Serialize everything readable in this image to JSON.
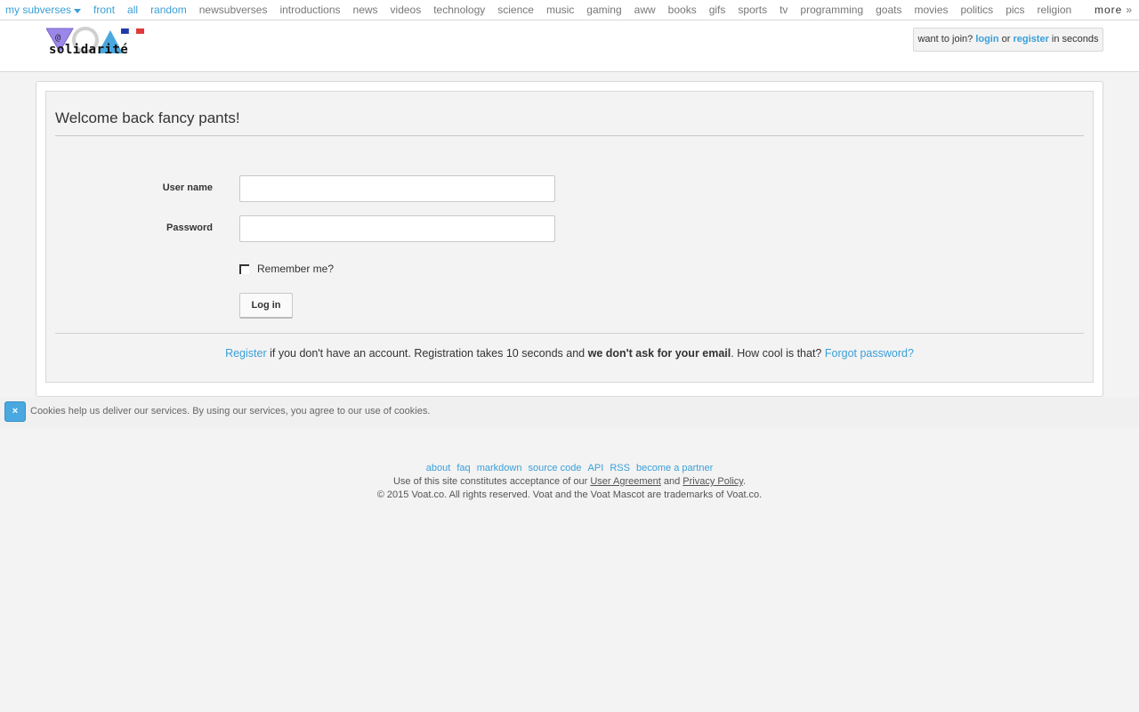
{
  "topbar": {
    "my_subverses": "my subverses",
    "items": [
      "front",
      "all",
      "random",
      "newsubverses",
      "introductions",
      "news",
      "videos",
      "technology",
      "science",
      "music",
      "gaming",
      "aww",
      "books",
      "gifs",
      "sports",
      "tv",
      "programming",
      "goats",
      "movies",
      "politics",
      "pics",
      "religion"
    ],
    "more": "more",
    "more_arrow": "»"
  },
  "header": {
    "logo_text": "solidarité",
    "join_prefix": "want to join?",
    "login": "login",
    "or": "or",
    "register": "register",
    "join_suffix": "in seconds"
  },
  "form": {
    "title": "Welcome back fancy pants!",
    "username_label": "User name",
    "username_value": "",
    "password_label": "Password",
    "password_value": "",
    "remember_label": "Remember me?",
    "login_button": "Log in",
    "register_link": "Register",
    "register_text1": "if you don't have an account. Registration takes 10 seconds and",
    "register_bold": "we don't ask for your email",
    "register_text2": ". How cool is that?",
    "forgot_link": "Forgot password?"
  },
  "cookie": {
    "close": "×",
    "text": "Cookies help us deliver our services. By using our services, you agree to our use of cookies."
  },
  "footer": {
    "links": [
      "about",
      "faq",
      "markdown",
      "source code",
      "API",
      "RSS",
      "become a partner"
    ],
    "terms_prefix": "Use of this site constitutes acceptance of our",
    "user_agreement": "User Agreement",
    "and": "and",
    "privacy_policy": "Privacy Policy",
    "period": ".",
    "copyright": "© 2015 Voat.co. All rights reserved. Voat and the Voat Mascot are trademarks of Voat.co."
  },
  "colors": {
    "link": "#3a9fd8",
    "background": "#f3f3f3"
  }
}
